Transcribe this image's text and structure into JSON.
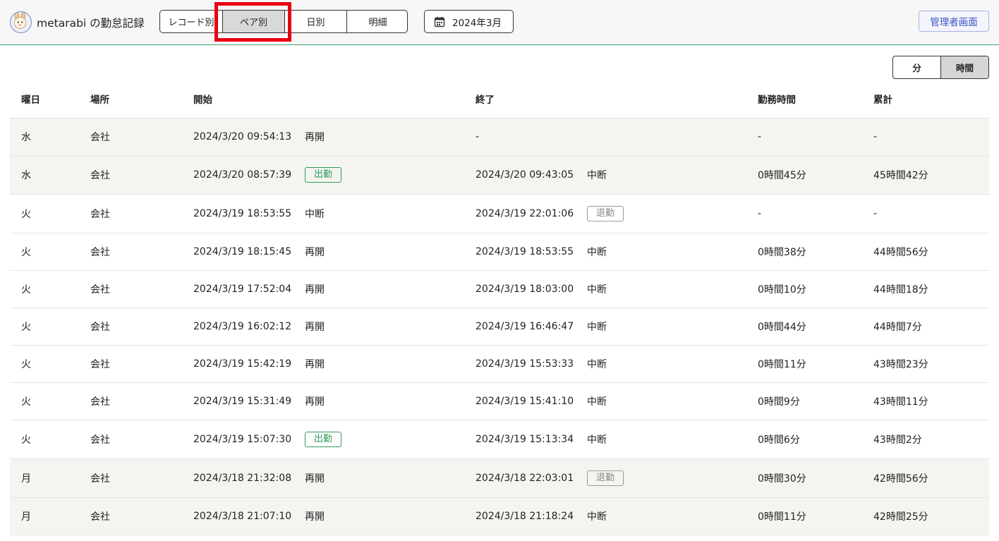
{
  "header": {
    "app_title": "metarabi の勤怠記録",
    "view_tabs": [
      "レコード別",
      "ペア別",
      "日別",
      "明細"
    ],
    "active_tab": "ペア別",
    "month_label": "2024年3月",
    "admin_label": "管理者画面"
  },
  "unit_toggle": {
    "minutes_label": "分",
    "hours_label": "時間",
    "active": "時間"
  },
  "columns": [
    "曜日",
    "場所",
    "開始",
    "終了",
    "勤務時間",
    "累計"
  ],
  "rows": [
    {
      "dow": "水",
      "place": "会社",
      "start": "2024/3/20 09:54:13",
      "start_kind": "再開",
      "end": "-",
      "end_kind": "",
      "work": "-",
      "total": "-",
      "shaded": true
    },
    {
      "dow": "水",
      "place": "会社",
      "start": "2024/3/20 08:57:39",
      "start_kind": "出勤",
      "end": "2024/3/20 09:43:05",
      "end_kind": "中断",
      "work": "0時間45分",
      "total": "45時間42分",
      "shaded": true
    },
    {
      "dow": "火",
      "place": "会社",
      "start": "2024/3/19 18:53:55",
      "start_kind": "中断",
      "end": "2024/3/19 22:01:06",
      "end_kind": "退勤",
      "work": "-",
      "total": "-",
      "shaded": false
    },
    {
      "dow": "火",
      "place": "会社",
      "start": "2024/3/19 18:15:45",
      "start_kind": "再開",
      "end": "2024/3/19 18:53:55",
      "end_kind": "中断",
      "work": "0時間38分",
      "total": "44時間56分",
      "shaded": false
    },
    {
      "dow": "火",
      "place": "会社",
      "start": "2024/3/19 17:52:04",
      "start_kind": "再開",
      "end": "2024/3/19 18:03:00",
      "end_kind": "中断",
      "work": "0時間10分",
      "total": "44時間18分",
      "shaded": false
    },
    {
      "dow": "火",
      "place": "会社",
      "start": "2024/3/19 16:02:12",
      "start_kind": "再開",
      "end": "2024/3/19 16:46:47",
      "end_kind": "中断",
      "work": "0時間44分",
      "total": "44時間7分",
      "shaded": false
    },
    {
      "dow": "火",
      "place": "会社",
      "start": "2024/3/19 15:42:19",
      "start_kind": "再開",
      "end": "2024/3/19 15:53:33",
      "end_kind": "中断",
      "work": "0時間11分",
      "total": "43時間23分",
      "shaded": false
    },
    {
      "dow": "火",
      "place": "会社",
      "start": "2024/3/19 15:31:49",
      "start_kind": "再開",
      "end": "2024/3/19 15:41:10",
      "end_kind": "中断",
      "work": "0時間9分",
      "total": "43時間11分",
      "shaded": false
    },
    {
      "dow": "火",
      "place": "会社",
      "start": "2024/3/19 15:07:30",
      "start_kind": "出勤",
      "end": "2024/3/19 15:13:34",
      "end_kind": "中断",
      "work": "0時間6分",
      "total": "43時間2分",
      "shaded": false
    },
    {
      "dow": "月",
      "place": "会社",
      "start": "2024/3/18 21:32:08",
      "start_kind": "再開",
      "end": "2024/3/18 22:03:01",
      "end_kind": "退勤",
      "work": "0時間30分",
      "total": "42時間56分",
      "shaded": true
    },
    {
      "dow": "月",
      "place": "会社",
      "start": "2024/3/18 21:07:10",
      "start_kind": "再開",
      "end": "2024/3/18 21:18:24",
      "end_kind": "中断",
      "work": "0時間11分",
      "total": "42時間25分",
      "shaded": true
    }
  ],
  "colors": {
    "header_bg": "#f7f7f8",
    "header_border": "#3aa66a",
    "highlight": "#e60012",
    "badge_green": "#2f9a58",
    "admin_text": "#3d54c7"
  }
}
